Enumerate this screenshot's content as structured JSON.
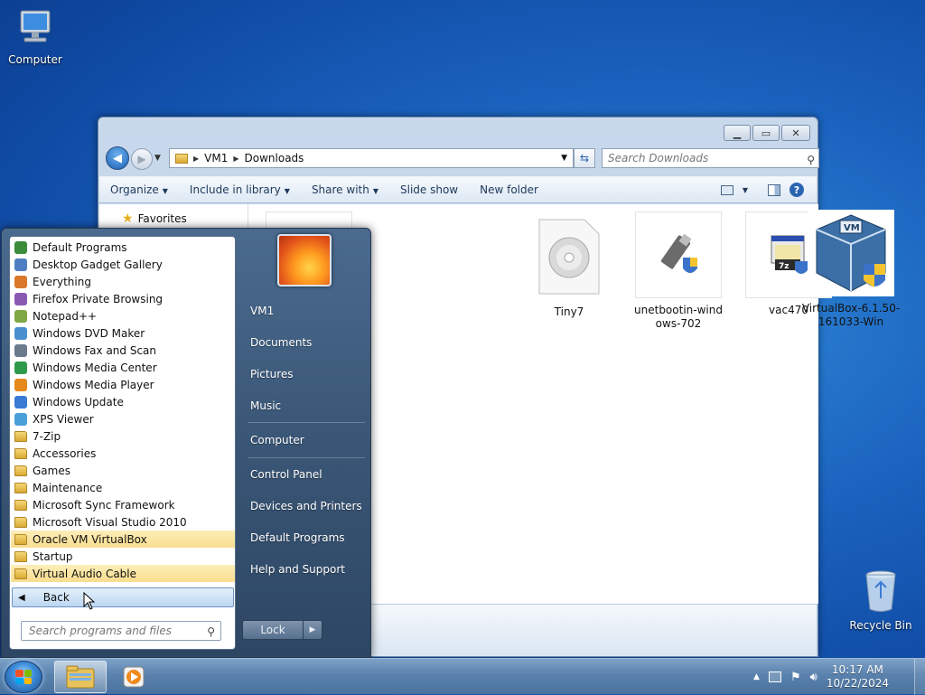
{
  "desktop": {
    "computer_label": "Computer",
    "recycle_label": "Recycle Bin"
  },
  "explorer": {
    "breadcrumb": [
      "VM1",
      "Downloads"
    ],
    "search_placeholder": "Search Downloads",
    "toolbar": {
      "organize": "Organize",
      "include": "Include in library",
      "share": "Share with",
      "slideshow": "Slide show",
      "new_folder": "New folder"
    },
    "nav_favorites": "Favorites",
    "files": [
      {
        "name": "Tiny7",
        "icon": "disc-image-icon"
      },
      {
        "name": "unetbootin-windows-702",
        "name_l1": "unetbootin-wind",
        "name_l2": "ows-702",
        "icon": "usb-installer-icon"
      },
      {
        "name": "vac470",
        "icon": "7zip-installer-icon"
      },
      {
        "name": "VirtualBox-6.1.50-161033-Win",
        "name_l1": "VirtualBox-6.1.50-",
        "name_l2": "161033-Win",
        "icon": "virtualbox-icon"
      }
    ]
  },
  "start_menu": {
    "programs": [
      {
        "label": "Default Programs",
        "icon": "default-programs-icon",
        "type": "app"
      },
      {
        "label": "Desktop Gadget Gallery",
        "icon": "gadget-icon",
        "type": "app"
      },
      {
        "label": "Everything",
        "icon": "everything-search-icon",
        "type": "app"
      },
      {
        "label": "Firefox Private Browsing",
        "icon": "firefox-private-icon",
        "type": "app"
      },
      {
        "label": "Notepad++",
        "icon": "notepad-plus-icon",
        "type": "app"
      },
      {
        "label": "Windows DVD Maker",
        "icon": "dvd-maker-icon",
        "type": "app"
      },
      {
        "label": "Windows Fax and Scan",
        "icon": "fax-scan-icon",
        "type": "app"
      },
      {
        "label": "Windows Media Center",
        "icon": "media-center-icon",
        "type": "app"
      },
      {
        "label": "Windows Media Player",
        "icon": "media-player-icon",
        "type": "app"
      },
      {
        "label": "Windows Update",
        "icon": "windows-update-icon",
        "type": "app"
      },
      {
        "label": "XPS Viewer",
        "icon": "xps-viewer-icon",
        "type": "app"
      },
      {
        "label": "7-Zip",
        "icon": "folder-icon",
        "type": "folder"
      },
      {
        "label": "Accessories",
        "icon": "folder-icon",
        "type": "folder"
      },
      {
        "label": "Games",
        "icon": "folder-icon",
        "type": "folder"
      },
      {
        "label": "Maintenance",
        "icon": "folder-icon",
        "type": "folder"
      },
      {
        "label": "Microsoft Sync Framework",
        "icon": "folder-icon",
        "type": "folder"
      },
      {
        "label": "Microsoft Visual Studio 2010",
        "icon": "folder-icon",
        "type": "folder"
      },
      {
        "label": "Oracle VM VirtualBox",
        "icon": "folder-icon",
        "type": "folder",
        "highlighted": true
      },
      {
        "label": "Startup",
        "icon": "folder-icon",
        "type": "folder"
      },
      {
        "label": "Virtual Audio Cable",
        "icon": "folder-icon",
        "type": "folder",
        "highlighted": true
      }
    ],
    "back_label": "Back",
    "search_placeholder": "Search programs and files",
    "right_items": [
      "VM1",
      "Documents",
      "Pictures",
      "Music",
      "Computer",
      "Control Panel",
      "Devices and Printers",
      "Default Programs",
      "Help and Support"
    ],
    "lock_label": "Lock"
  },
  "taskbar": {
    "time": "10:17 AM",
    "date": "10/22/2024"
  },
  "colors": {
    "highlight": "#f9dd8f",
    "accent": "#1b63bf"
  }
}
